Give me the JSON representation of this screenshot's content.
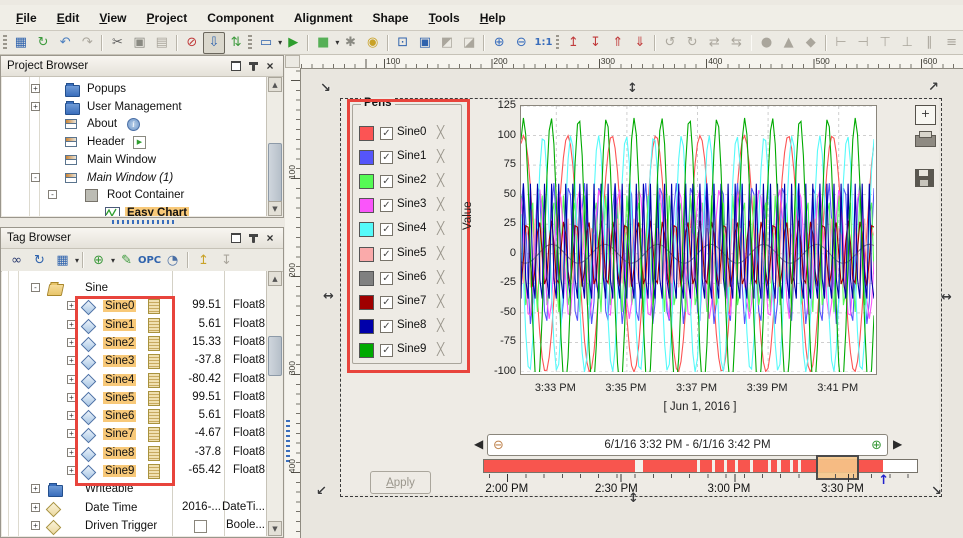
{
  "menu": {
    "items": [
      {
        "label": "File",
        "mnemonic": true
      },
      {
        "label": "Edit",
        "mnemonic": true
      },
      {
        "label": "View",
        "mnemonic": true
      },
      {
        "label": "Project",
        "mnemonic": true
      },
      {
        "label": "Component",
        "mnemonic": false
      },
      {
        "label": "Alignment",
        "mnemonic": false
      },
      {
        "label": "Shape",
        "mnemonic": false
      },
      {
        "label": "Tools",
        "mnemonic": true
      },
      {
        "label": "Help",
        "mnemonic": true
      }
    ]
  },
  "toolbar": {
    "icons": [
      {
        "name": "drag-handle"
      },
      {
        "name": "save-all-icon",
        "glyph": "▦",
        "color": "#2f63ad"
      },
      {
        "name": "update-project-icon",
        "glyph": "↻",
        "color": "#3c9a3c"
      },
      {
        "name": "undo-icon",
        "glyph": "↶",
        "color": "#4a7ebf"
      },
      {
        "name": "redo-icon",
        "glyph": "↷",
        "color": "#aaa69c",
        "disabled": true
      },
      {
        "name": "sep"
      },
      {
        "name": "cut-icon",
        "glyph": "✂",
        "color": "#5a5a5a"
      },
      {
        "name": "copy-icon",
        "glyph": "▣",
        "color": "#8a8a82"
      },
      {
        "name": "paste-icon",
        "glyph": "▤",
        "color": "#aaa69c",
        "disabled": true
      },
      {
        "name": "sep"
      },
      {
        "name": "db-cancel-icon",
        "glyph": "⊘",
        "color": "#c03a3a"
      },
      {
        "name": "db-download-icon",
        "glyph": "⇩",
        "color": "#2f63ad",
        "active": true
      },
      {
        "name": "db-sync-icon",
        "glyph": "⇅",
        "color": "#3c9a3c"
      },
      {
        "name": "drag-handle"
      },
      {
        "name": "open-window-icon",
        "glyph": "▭",
        "color": "#2f63ad",
        "caret": true
      },
      {
        "name": "preview-play-icon",
        "glyph": "▶",
        "color": "#2e9e2e"
      },
      {
        "name": "sep"
      },
      {
        "name": "component-palette-icon",
        "glyph": "■",
        "color": "#57b057",
        "caret": true
      },
      {
        "name": "settings-gears-icon",
        "glyph": "✱",
        "color": "#8a8a82"
      },
      {
        "name": "security-lock-icon",
        "glyph": "◉",
        "color": "#c9a227"
      },
      {
        "name": "sep"
      },
      {
        "name": "selection-bounds-icon",
        "glyph": "⊡",
        "color": "#2f63ad"
      },
      {
        "name": "crop-view-icon",
        "glyph": "▣",
        "color": "#2f63ad"
      },
      {
        "name": "paint-mode-1-icon",
        "glyph": "◩",
        "color": "#aaa69c",
        "disabled": true
      },
      {
        "name": "paint-mode-2-icon",
        "glyph": "◪",
        "color": "#aaa69c",
        "disabled": true
      },
      {
        "name": "sep"
      },
      {
        "name": "zoom-in-icon",
        "glyph": "⊕",
        "color": "#3a6ebc"
      },
      {
        "name": "zoom-out-icon",
        "glyph": "⊖",
        "color": "#3a6ebc"
      },
      {
        "name": "zoom-actual-icon",
        "glyph": "1:1",
        "color": "#3a6ebc",
        "small": true
      },
      {
        "name": "drag-handle"
      },
      {
        "name": "move-forward-icon",
        "glyph": "↥",
        "color": "#c03a3a"
      },
      {
        "name": "move-backward-icon",
        "glyph": "↧",
        "color": "#c03a3a"
      },
      {
        "name": "bring-to-front-icon",
        "glyph": "⇑",
        "color": "#c03a3a"
      },
      {
        "name": "send-to-back-icon",
        "glyph": "⇓",
        "color": "#c03a3a"
      },
      {
        "name": "sep"
      },
      {
        "name": "rotate-ccw-icon",
        "glyph": "↺",
        "color": "#aaa69c",
        "disabled": true
      },
      {
        "name": "rotate-cw-icon",
        "glyph": "↻",
        "color": "#aaa69c",
        "disabled": true
      },
      {
        "name": "flip-horizontal-icon",
        "glyph": "⇄",
        "color": "#aaa69c",
        "disabled": true
      },
      {
        "name": "skew-icon",
        "glyph": "⇆",
        "color": "#aaa69c",
        "disabled": true
      },
      {
        "name": "sep"
      },
      {
        "name": "shape-union-icon",
        "glyph": "●",
        "color": "#aaa69c",
        "disabled": true
      },
      {
        "name": "shape-difference-icon",
        "glyph": "▲",
        "color": "#aaa69c",
        "disabled": true
      },
      {
        "name": "shape-intersect-icon",
        "glyph": "◆",
        "color": "#aaa69c",
        "disabled": true
      },
      {
        "name": "sep"
      },
      {
        "name": "align-left-icon",
        "glyph": "⊢",
        "color": "#aaa69c",
        "disabled": true
      },
      {
        "name": "align-right-icon",
        "glyph": "⊣",
        "color": "#aaa69c",
        "disabled": true
      },
      {
        "name": "align-top-icon",
        "glyph": "⊤",
        "color": "#aaa69c",
        "disabled": true
      },
      {
        "name": "align-bottom-icon",
        "glyph": "⊥",
        "color": "#aaa69c",
        "disabled": true
      },
      {
        "name": "center-horizontal-icon",
        "glyph": "∥",
        "color": "#aaa69c",
        "disabled": true
      },
      {
        "name": "center-vertical-icon",
        "glyph": "≡",
        "color": "#aaa69c",
        "disabled": true
      }
    ]
  },
  "project_browser": {
    "title": "Project Browser",
    "items": [
      {
        "label": "Popups",
        "icon": "folder",
        "expand": "+",
        "depth": 0
      },
      {
        "label": "User Management",
        "icon": "folder",
        "expand": "+",
        "depth": 0
      },
      {
        "label": "About",
        "icon": "window",
        "badge": "info",
        "depth": 0
      },
      {
        "label": "Header",
        "icon": "window",
        "badge": "play",
        "depth": 0
      },
      {
        "label": "Main Window",
        "icon": "window",
        "depth": 0
      },
      {
        "label": "Main Window (1)",
        "icon": "window",
        "expand": "-",
        "italic": true,
        "depth": 0
      },
      {
        "label": "Root Container",
        "icon": "container",
        "expand": "-",
        "depth": 1
      },
      {
        "label": "Easy Chart",
        "icon": "chart",
        "depth": 2,
        "selected": true
      }
    ]
  },
  "tag_browser": {
    "title": "Tag Browser",
    "tools": [
      {
        "name": "search-binoculars-icon",
        "glyph": "∞",
        "color": "#2a3a6e"
      },
      {
        "name": "refresh-tags-icon",
        "glyph": "↻",
        "color": "#2f63ad"
      },
      {
        "name": "tag-grid-icon",
        "glyph": "▦",
        "color": "#2f63ad",
        "caret": true
      },
      {
        "name": "sep"
      },
      {
        "name": "add-tag-icon",
        "glyph": "⊕",
        "color": "#3c9a3c",
        "caret": true
      },
      {
        "name": "edit-tag-icon",
        "glyph": "✎",
        "color": "#3c9a3c"
      },
      {
        "name": "opc-browse-icon",
        "glyph": "OPC",
        "color": "#2f63ad",
        "small": true
      },
      {
        "name": "scan-class-clock-icon",
        "glyph": "◔",
        "color": "#4a6fa5"
      },
      {
        "name": "sep"
      },
      {
        "name": "import-tags-icon",
        "glyph": "↥",
        "color": "#c9a227"
      },
      {
        "name": "export-tags-icon",
        "glyph": "↧",
        "color": "#aaa69c",
        "disabled": true
      }
    ],
    "rows": [
      {
        "label": "Sine",
        "type": "folder-open",
        "expand": "-",
        "depth": 1
      },
      {
        "label": "Sine0",
        "value": "99.51",
        "datatype": "Float8",
        "type": "tag",
        "expand": "+",
        "depth": 2,
        "selected": true,
        "history": true
      },
      {
        "label": "Sine1",
        "value": "5.61",
        "datatype": "Float8",
        "type": "tag",
        "expand": "+",
        "depth": 2,
        "selected": true,
        "history": true
      },
      {
        "label": "Sine2",
        "value": "15.33",
        "datatype": "Float8",
        "type": "tag",
        "expand": "+",
        "depth": 2,
        "selected": true,
        "history": true
      },
      {
        "label": "Sine3",
        "value": "-37.8",
        "datatype": "Float8",
        "type": "tag",
        "expand": "+",
        "depth": 2,
        "selected": true,
        "history": true
      },
      {
        "label": "Sine4",
        "value": "-80.42",
        "datatype": "Float8",
        "type": "tag",
        "expand": "+",
        "depth": 2,
        "selected": true,
        "history": true
      },
      {
        "label": "Sine5",
        "value": "99.51",
        "datatype": "Float8",
        "type": "tag",
        "expand": "+",
        "depth": 2,
        "selected": true,
        "history": true
      },
      {
        "label": "Sine6",
        "value": "5.61",
        "datatype": "Float8",
        "type": "tag",
        "expand": "+",
        "depth": 2,
        "selected": true,
        "history": true
      },
      {
        "label": "Sine7",
        "value": "-4.67",
        "datatype": "Float8",
        "type": "tag",
        "expand": "+",
        "depth": 2,
        "selected": true,
        "history": true
      },
      {
        "label": "Sine8",
        "value": "-37.8",
        "datatype": "Float8",
        "type": "tag",
        "expand": "+",
        "depth": 2,
        "selected": true,
        "history": true
      },
      {
        "label": "Sine9",
        "value": "-65.42",
        "datatype": "Float8",
        "type": "tag",
        "expand": "+",
        "depth": 2,
        "selected": true,
        "history": true
      },
      {
        "label": "Writeable",
        "type": "folder",
        "expand": "+",
        "depth": 1
      },
      {
        "label": "Date Time",
        "value": "2016-...",
        "datatype": "DateTi...",
        "type": "tag-tan",
        "expand": "+",
        "depth": 1
      },
      {
        "label": "Driven Trigger",
        "checkbox": true,
        "datatype": "Boole...",
        "type": "tag-tan",
        "expand": "+",
        "depth": 1
      }
    ]
  },
  "canvas": {
    "h_ruler": [
      "100",
      "200",
      "300",
      "400",
      "500",
      "600"
    ],
    "v_ruler": [
      "100",
      "200",
      "300",
      "400"
    ],
    "handles": [
      {
        "name": "resize-handle-top-left",
        "glyph": "↘"
      },
      {
        "name": "resize-handle-top-center",
        "glyph": "↕"
      },
      {
        "name": "resize-handle-top-right",
        "glyph": "↗"
      },
      {
        "name": "resize-handle-mid-left",
        "glyph": "↔"
      },
      {
        "name": "resize-handle-mid-right",
        "glyph": "↔"
      },
      {
        "name": "resize-handle-bottom-left",
        "glyph": "↙"
      },
      {
        "name": "resize-handle-bottom-center",
        "glyph": "↕"
      },
      {
        "name": "resize-handle-bottom-right",
        "glyph": "↘"
      }
    ]
  },
  "chart": {
    "pens_title": "Pens",
    "pen_check_glyph": "✓",
    "pen_remove_glyph": "╳",
    "y_axis_label": "Value",
    "date_label": "[ Jun 1, 2016 ]",
    "range_text": "6/1/16 3:32 PM - 6/1/16 3:42 PM",
    "range_prev_glyph": "◀",
    "range_next_glyph": "▶",
    "zoom_out_glyph": "⊖",
    "zoom_in_glyph": "⊕",
    "apply_label": "Apply",
    "maximize_glyph": "+",
    "timeline": {
      "labels": [
        {
          "text": "2:00 PM",
          "frac": 0.055
        },
        {
          "text": "2:30 PM",
          "frac": 0.308
        },
        {
          "text": "3:00 PM",
          "frac": 0.568
        },
        {
          "text": "3:30 PM",
          "frac": 0.83
        }
      ],
      "red_end_frac": 0.922,
      "gaps": [
        [
          0.349,
          0.368
        ],
        [
          0.492,
          0.499
        ],
        [
          0.526,
          0.533
        ],
        [
          0.554,
          0.561
        ],
        [
          0.579,
          0.586
        ],
        [
          0.614,
          0.621
        ],
        [
          0.655,
          0.662
        ],
        [
          0.676,
          0.685
        ],
        [
          0.706,
          0.713
        ],
        [
          0.726,
          0.733
        ]
      ],
      "selection": [
        0.77,
        0.858
      ],
      "marker_frac": 0.922,
      "marker_glyph": "↑"
    }
  },
  "chart_data": {
    "type": "line",
    "title": "",
    "xlabel": "[ Jun 1, 2016 ]",
    "ylabel": "Value",
    "x_range": [
      "6/1/16 3:32 PM",
      "6/1/16 3:42 PM"
    ],
    "x_ticks": [
      "3:33 PM",
      "3:35 PM",
      "3:37 PM",
      "3:39 PM",
      "3:41 PM"
    ],
    "x_tick_seconds": [
      60,
      180,
      300,
      420,
      540
    ],
    "duration_s": 600,
    "sample_step_s": 4,
    "y_ticks": [
      125,
      100,
      75,
      50,
      25,
      0,
      -25,
      -50,
      -75,
      -100
    ],
    "ylim": [
      -100,
      125
    ],
    "grid": true,
    "legend_position": "left-pens-panel",
    "series": [
      {
        "name": "Sine0",
        "color": "#fc5454",
        "amplitude": 100,
        "period_s": 75,
        "phase": 1.2
      },
      {
        "name": "Sine1",
        "color": "#5555fa",
        "amplitude": 60,
        "period_s": 26,
        "phase": 0.7
      },
      {
        "name": "Sine2",
        "color": "#55fa55",
        "amplitude": 50,
        "period_s": 18,
        "phase": 1.4
      },
      {
        "name": "Sine3",
        "color": "#fa55fa",
        "amplitude": 55,
        "period_s": 34,
        "phase": 2.1
      },
      {
        "name": "Sine4",
        "color": "#55fafa",
        "amplitude": 100,
        "period_s": 47,
        "phase": 2.8
      },
      {
        "name": "Sine5",
        "color": "#faaaaa",
        "amplitude": 30,
        "period_s": 14,
        "phase": 3.5
      },
      {
        "name": "Sine6",
        "color": "#808080",
        "amplitude": 8,
        "period_s": 90,
        "phase": 4.2
      },
      {
        "name": "Sine7",
        "color": "#a00000",
        "amplitude": 28,
        "period_s": 21,
        "phase": 4.9
      },
      {
        "name": "Sine8",
        "color": "#0000aa",
        "amplitude": 60,
        "period_s": 12,
        "phase": 5.6
      },
      {
        "name": "Sine9",
        "color": "#00aa00",
        "amplitude": 115,
        "period_s": 47,
        "phase": 1.0
      }
    ]
  }
}
